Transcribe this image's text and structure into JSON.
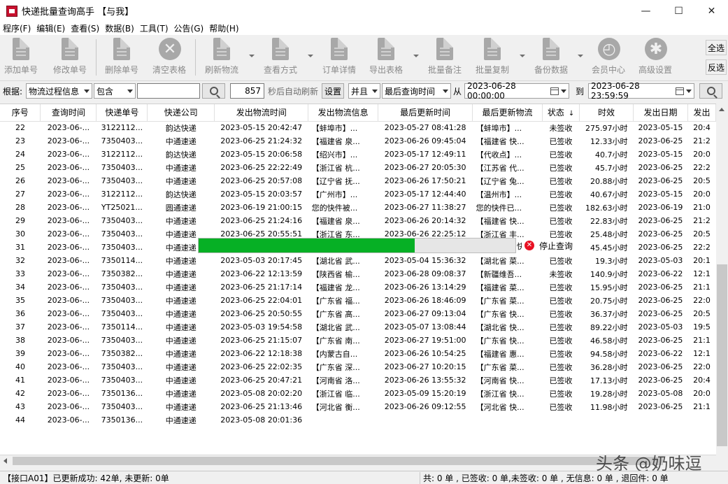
{
  "window": {
    "title": "快递批量查询高手 【与我】",
    "minimize": "—",
    "maximize": "☐",
    "close": "✕"
  },
  "menu": [
    "程序(F)",
    "编辑(E)",
    "查看(S)",
    "数据(B)",
    "工具(T)",
    "公告(G)",
    "帮助(H)"
  ],
  "toolbar": {
    "buttons": [
      {
        "label": "添加单号",
        "icon": "add-document-icon"
      },
      {
        "label": "修改单号",
        "icon": "edit-document-icon"
      },
      {
        "label": "删除单号",
        "icon": "delete-document-icon"
      },
      {
        "label": "清空表格",
        "icon": "clear-table-icon"
      },
      {
        "label": "刷新物流",
        "icon": "refresh-document-icon"
      },
      {
        "label": "查看方式",
        "icon": "view-mode-icon"
      },
      {
        "label": "订单详情",
        "icon": "order-detail-icon"
      },
      {
        "label": "导出表格",
        "icon": "export-table-icon"
      },
      {
        "label": "批量备注",
        "icon": "batch-note-icon"
      },
      {
        "label": "批量复制",
        "icon": "batch-copy-icon"
      },
      {
        "label": "备份数据",
        "icon": "backup-icon"
      },
      {
        "label": "会员中心",
        "icon": "clock-icon"
      },
      {
        "label": "高级设置",
        "icon": "gear-icon"
      }
    ],
    "select_all": "全选",
    "invert_select": "反选"
  },
  "filter": {
    "label_by": "根据:",
    "field": "物流过程信息",
    "match": "包含",
    "keyword": "",
    "interval": "857",
    "interval_suffix": "秒后自动刷新",
    "settings": "设置",
    "logic": "并且",
    "time_field": "最后查询时间",
    "from_label": "从",
    "from": "2023-06-28 00:00:00",
    "to_label": "到",
    "to": "2023-06-28 23:59:59"
  },
  "table": {
    "columns": [
      "序号",
      "查询时间",
      "快递单号",
      "快递公司",
      "发出物流时间",
      "发出物流信息",
      "最后更新时间",
      "最后更新物流",
      "状态",
      "时效",
      "发出日期",
      "发出"
    ],
    "rows": [
      [
        "22",
        "2023-06-...",
        "3122112...",
        "韵达快递",
        "2023-05-15 20:42:47",
        "【蚌埠市】...",
        "2023-05-27 08:41:28",
        "【蚌埠市】...",
        "未签收",
        "275.97小时",
        "2023-05-15",
        "20:4"
      ],
      [
        "23",
        "2023-06-...",
        "7350403...",
        "中通速递",
        "2023-06-25 21:24:32",
        "【福建省 泉...",
        "2023-06-26 09:45:04",
        "【福建省 快...",
        "已签收",
        "12.33小时",
        "2023-06-25",
        "21:2"
      ],
      [
        "24",
        "2023-06-...",
        "3122112...",
        "韵达快递",
        "2023-05-15 20:06:58",
        "【绍兴市】...",
        "2023-05-17 12:49:11",
        "【代收点】...",
        "已签收",
        "40.7小时",
        "2023-05-15",
        "20:0"
      ],
      [
        "25",
        "2023-06-...",
        "7350403...",
        "中通速递",
        "2023-06-25 22:22:49",
        "【浙江省 杭...",
        "2023-06-27 20:05:30",
        "【江苏省 代...",
        "已签收",
        "45.7小时",
        "2023-06-25",
        "22:2"
      ],
      [
        "26",
        "2023-06-...",
        "7350403...",
        "中通速递",
        "2023-06-25 20:57:08",
        "【辽宁省 抚...",
        "2023-06-26 17:50:21",
        "【辽宁省 兔...",
        "已签收",
        "20.88小时",
        "2023-06-25",
        "20:5"
      ],
      [
        "27",
        "2023-06-...",
        "3122112...",
        "韵达快递",
        "2023-05-15 20:03:57",
        "【广州市】...",
        "2023-05-17 12:44:40",
        "【温州市】...",
        "已签收",
        "40.67小时",
        "2023-05-15",
        "20:0"
      ],
      [
        "28",
        "2023-06-...",
        "YT25021...",
        "圆通速递",
        "2023-06-19 21:00:15",
        "您的快件被...",
        "2023-06-27 11:38:27",
        "您的快件已...",
        "已签收",
        "182.63小时",
        "2023-06-19",
        "21:0"
      ],
      [
        "29",
        "2023-06-...",
        "7350403...",
        "中通速递",
        "2023-06-25 21:24:16",
        "【福建省 泉...",
        "2023-06-26 20:14:32",
        "【福建省 快...",
        "已签收",
        "22.83小时",
        "2023-06-25",
        "21:2"
      ],
      [
        "30",
        "2023-06-...",
        "7350403...",
        "中通速递",
        "2023-06-25 20:55:51",
        "【浙江省 东...",
        "2023-06-26 22:25:12",
        "【浙江省 丰...",
        "已签收",
        "25.48小时",
        "2023-06-25",
        "20:5"
      ],
      [
        "31",
        "2023-06-...",
        "7350403...",
        "中通速递",
        "",
        "",
        "",
        "",
        "",
        "45.45小时",
        "2023-06-25",
        "22:2"
      ],
      [
        "32",
        "2023-06-...",
        "7350114...",
        "中通速递",
        "2023-05-03 20:17:45",
        "【湖北省 武...",
        "2023-05-04 15:36:32",
        "【湖北省 菜...",
        "已签收",
        "19.3小时",
        "2023-05-03",
        "20:1"
      ],
      [
        "33",
        "2023-06-...",
        "7350382...",
        "中通速递",
        "2023-06-22 12:13:59",
        "【陕西省 榆...",
        "2023-06-28 09:08:37",
        "【新疆维吾...",
        "未签收",
        "140.9小时",
        "2023-06-22",
        "12:1"
      ],
      [
        "34",
        "2023-06-...",
        "7350403...",
        "中通速递",
        "2023-06-25 21:17:14",
        "【福建省 龙...",
        "2023-06-26 13:14:29",
        "【福建省 菜...",
        "已签收",
        "15.95小时",
        "2023-06-25",
        "21:1"
      ],
      [
        "35",
        "2023-06-...",
        "7350403...",
        "中通速递",
        "2023-06-25 22:04:01",
        "【广东省 福...",
        "2023-06-26 18:46:09",
        "【广东省 菜...",
        "已签收",
        "20.75小时",
        "2023-06-25",
        "22:0"
      ],
      [
        "36",
        "2023-06-...",
        "7350403...",
        "中通速递",
        "2023-06-25 20:50:55",
        "【广东省 高...",
        "2023-06-27 09:13:04",
        "【广东省 快...",
        "已签收",
        "36.37小时",
        "2023-06-25",
        "20:5"
      ],
      [
        "37",
        "2023-06-...",
        "7350114...",
        "中通速递",
        "2023-05-03 19:54:58",
        "【湖北省 武...",
        "2023-05-07 13:08:44",
        "【湖北省 快...",
        "已签收",
        "89.22小时",
        "2023-05-03",
        "19:5"
      ],
      [
        "38",
        "2023-06-...",
        "7350403...",
        "中通速递",
        "2023-06-25 21:15:07",
        "【广东省 南...",
        "2023-06-27 19:51:00",
        "【广东省 快...",
        "已签收",
        "46.58小时",
        "2023-06-25",
        "21:1"
      ],
      [
        "39",
        "2023-06-...",
        "7350382...",
        "中通速递",
        "2023-06-22 12:18:38",
        "【内蒙古自...",
        "2023-06-26 10:54:25",
        "【福建省 惠...",
        "已签收",
        "94.58小时",
        "2023-06-22",
        "12:1"
      ],
      [
        "40",
        "2023-06-...",
        "7350403...",
        "中通速递",
        "2023-06-25 22:02:35",
        "【广东省 深...",
        "2023-06-27 10:20:15",
        "【广东省 菜...",
        "已签收",
        "36.28小时",
        "2023-06-25",
        "22:0"
      ],
      [
        "41",
        "2023-06-...",
        "7350403...",
        "中通速递",
        "2023-06-25 20:47:21",
        "【河南省 洛...",
        "2023-06-26 13:55:32",
        "【河南省 快...",
        "已签收",
        "17.13小时",
        "2023-06-25",
        "20:4"
      ],
      [
        "42",
        "2023-06-...",
        "7350136...",
        "中通速递",
        "2023-05-08 20:02:20",
        "【浙江省 临...",
        "2023-05-09 15:20:19",
        "【浙江省 快...",
        "已签收",
        "19.28小时",
        "2023-05-08",
        "20:0"
      ],
      [
        "43",
        "2023-06-...",
        "7350403...",
        "中通速递",
        "2023-06-25 21:13:46",
        "【河北省 衡...",
        "2023-06-26 09:12:55",
        "【河北省 快...",
        "已签收",
        "11.98小时",
        "2023-06-25",
        "21:1"
      ],
      [
        "44",
        "2023-06-...",
        "7350136...",
        "中通速递",
        "2023-05-08 20:01:36",
        "",
        "",
        "",
        "",
        "",
        "",
        ""
      ]
    ]
  },
  "progress": {
    "fraction": 0.683,
    "stop_label": "停止查询",
    "row31_tail": "快"
  },
  "colors": {
    "progress": "#06b025",
    "stop": "#e81123"
  },
  "watermark": "头条 @奶味逗",
  "status": {
    "left": "【接口A01】已更新成功: 42单, 未更新: 0单",
    "right": "共: 0 单 , 已签收: 0 单,未签收: 0 单 , 无信息: 0 单 , 退回件: 0 单"
  }
}
